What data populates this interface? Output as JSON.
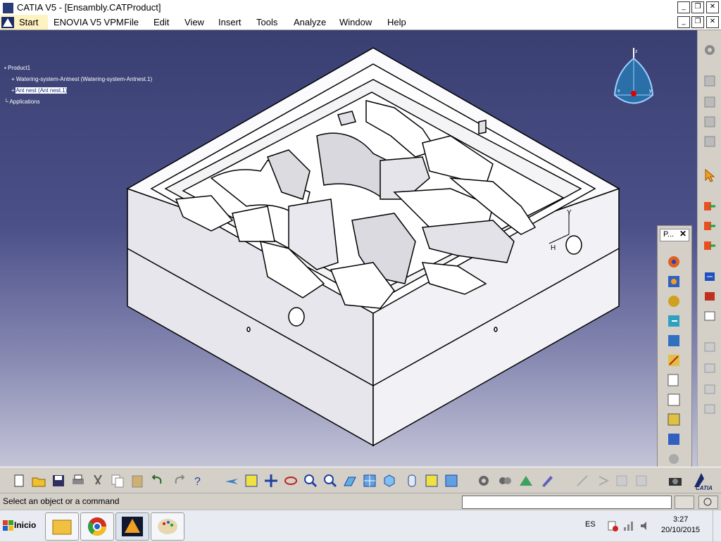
{
  "window": {
    "title": "CATIA V5 - [Ensambly.CATProduct]"
  },
  "menu": {
    "start": "Start",
    "enovia": "ENOVIA V5 VPM",
    "file": "File",
    "edit": "Edit",
    "view": "View",
    "insert": "Insert",
    "tools": "Tools",
    "analyze": "Analyze",
    "window": "Window",
    "help": "Help"
  },
  "tree": {
    "root": "Product1",
    "child1": "Watering-system-Antnest (Watering-system-Antnest.1)",
    "child2": "Ant nest (Ant nest.1)",
    "applications": "Applications"
  },
  "compass": {
    "x": "x",
    "y": "y",
    "z": "z"
  },
  "axis": {
    "y": "Y",
    "h": "H"
  },
  "palette": {
    "title": "P..."
  },
  "status": {
    "message": "Select an object or a command"
  },
  "taskbar": {
    "start": "Inicio",
    "lang": "ES",
    "time": "3:27",
    "date": "20/10/2015"
  },
  "colors": {
    "viewport_top": "#3a3f72",
    "viewport_bottom": "#c4c4d8",
    "selection": "#1c2b80"
  },
  "icons": [
    "new-icon",
    "open-icon",
    "save-icon",
    "print-icon",
    "cut-icon",
    "copy-icon",
    "paste-icon",
    "undo-icon",
    "redo-icon",
    "whats-this-icon",
    "fly-mode-icon",
    "fit-all-icon",
    "pan-icon",
    "rotate-icon",
    "zoom-in-icon",
    "zoom-out-icon",
    "normal-view-icon",
    "multi-view-icon",
    "iso-view-icon",
    "hide-show-icon",
    "swap-visible-icon",
    "manipulation-icon",
    "gear-icon",
    "catia-logo-icon"
  ]
}
